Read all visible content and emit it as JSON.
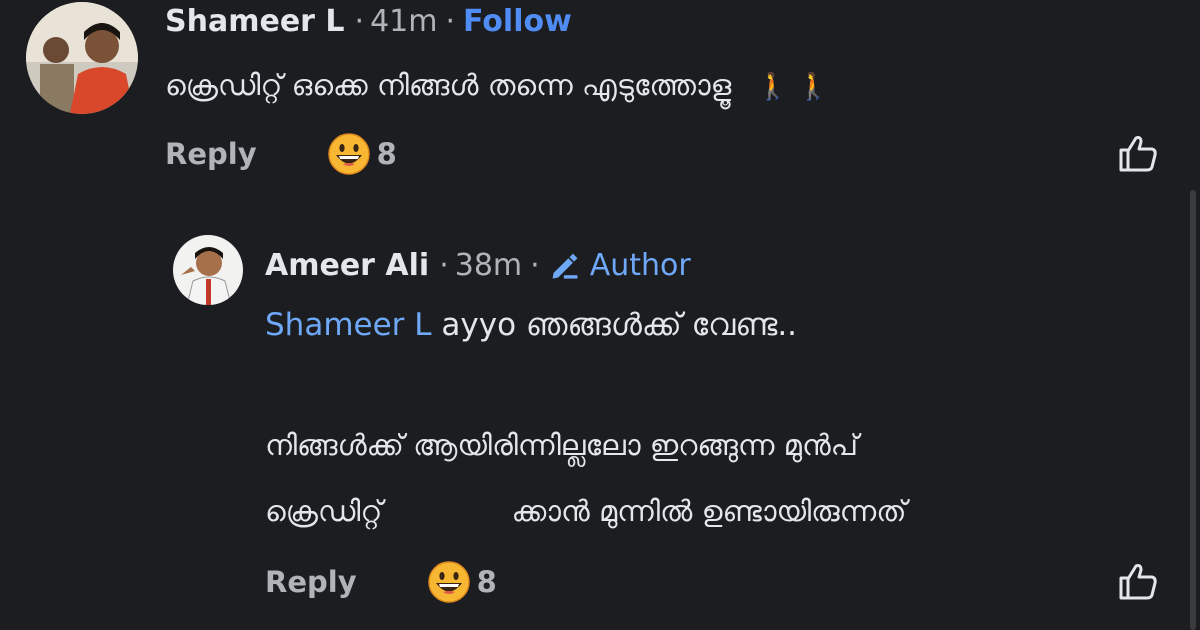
{
  "comment": {
    "author": "Shameer L",
    "time": "41m",
    "dot1": "·",
    "dot2": "·",
    "follow_label": "Follow",
    "text": "ക്രെഡിറ്റ് ഒക്കെ നിങ്ങൾ തന്നെ എടുത്തോളൂ",
    "text_emoji": "🚶 🚶",
    "reply_label": "Reply",
    "reaction_count": "8",
    "reaction_icon": "grinning-face-icon",
    "like_icon": "thumbs-up-icon"
  },
  "reply": {
    "author": "Ameer Ali",
    "time": "38m",
    "dot1": "·",
    "dot2": "·",
    "badge_label": "Author",
    "badge_icon": "pencil-icon",
    "mention": "Shameer L",
    "line1_rest": " ayyo ഞങ്ങൾക്ക് വേണ്ട..",
    "line2": "നിങ്ങൾക്ക് ആയിരിന്നില്ലലോ ഇറങ്ങുന്ന മുൻപ്",
    "line3_start": "ക്രെഡിറ്റ്",
    "line3_end": "ക്കാൻ മുന്നിൽ ഉണ്ടായിരുന്നത്",
    "reply_label": "Reply",
    "reaction_count": "8",
    "reaction_icon": "grinning-face-icon",
    "like_icon": "thumbs-up-icon"
  },
  "colors": {
    "background": "#1c1d20",
    "link": "#4f8df5",
    "mention": "#6ea8f7",
    "text": "#e4e6eb",
    "muted": "#b0b3b8"
  }
}
